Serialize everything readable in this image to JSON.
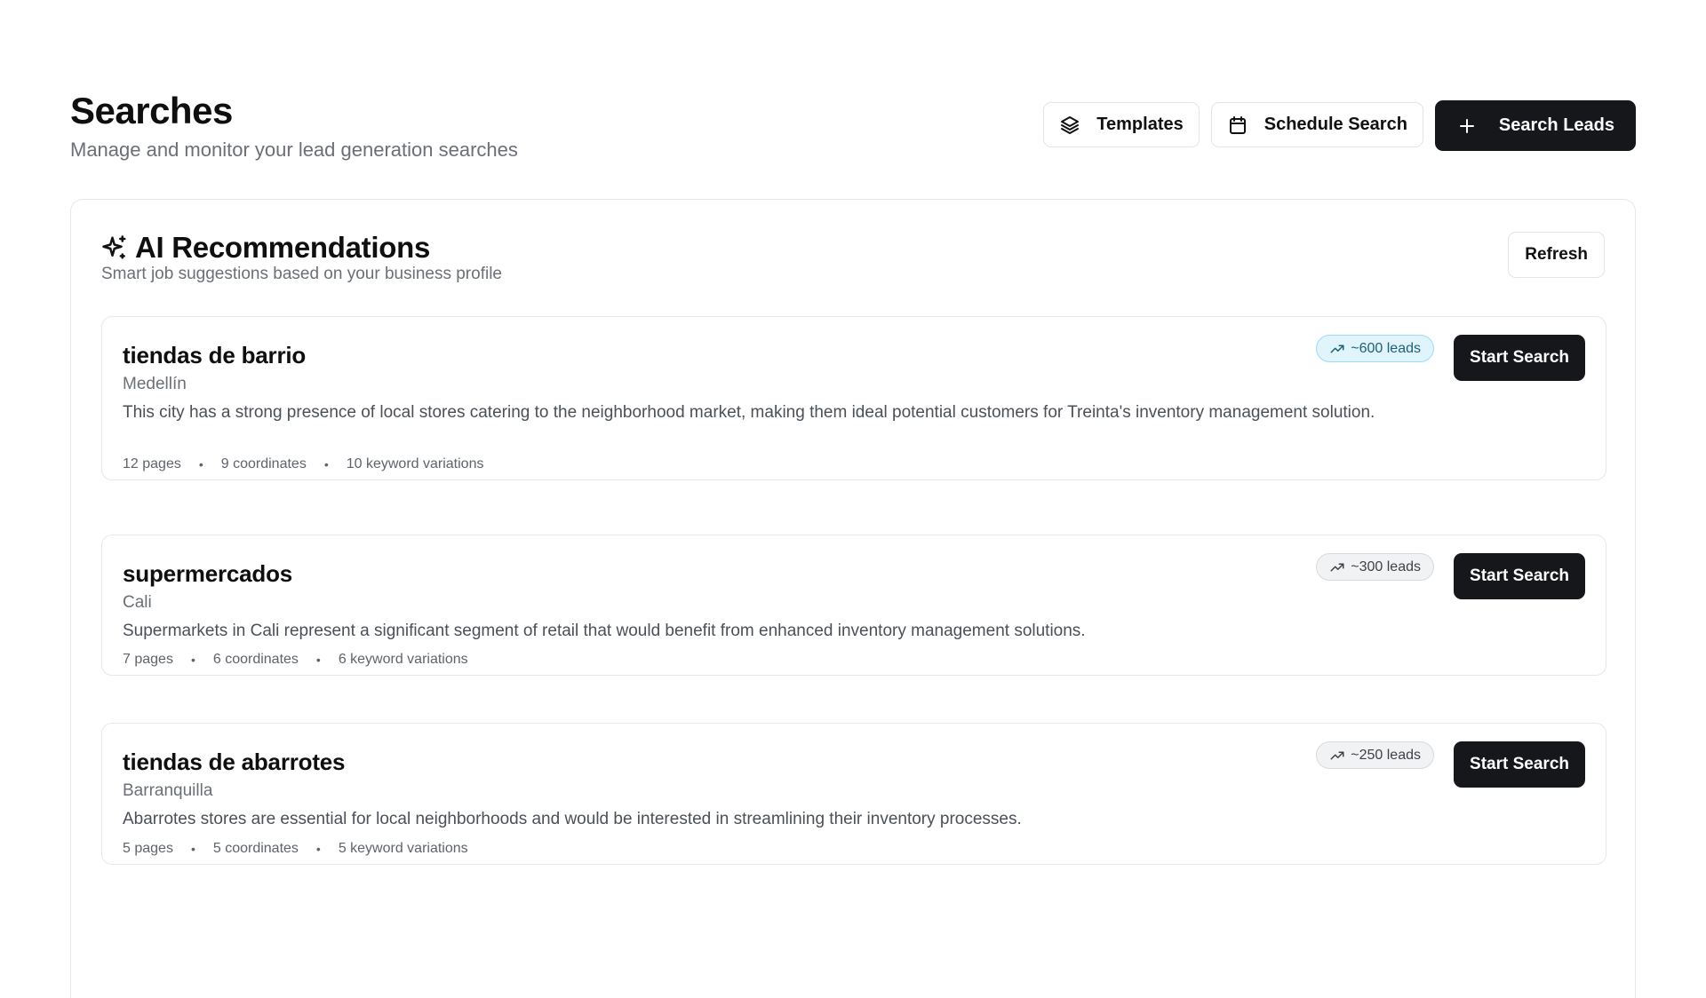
{
  "header": {
    "title": "Searches",
    "subtitle": "Manage and monitor your lead generation searches",
    "templates_label": "Templates",
    "schedule_label": "Schedule Search",
    "search_leads_label": "Search Leads"
  },
  "recommendations": {
    "title": "AI Recommendations",
    "subtitle": "Smart job suggestions based on your business profile",
    "refresh_label": "Refresh",
    "start_label": "Start Search",
    "items": [
      {
        "name": "tiendas de barrio",
        "city": "Medellín",
        "leads": "~600 leads",
        "description": "This city has a strong presence of local stores catering to the neighborhood market, making them ideal potential customers for Treinta's inventory management solution.",
        "pages": "12 pages",
        "coordinates": "9 coordinates",
        "keywords": "10 keyword variations"
      },
      {
        "name": "supermercados",
        "city": "Cali",
        "leads": "~300 leads",
        "description": "Supermarkets in Cali represent a significant segment of retail that would benefit from enhanced inventory management solutions.",
        "pages": "7 pages",
        "coordinates": "6 coordinates",
        "keywords": "6 keyword variations"
      },
      {
        "name": "tiendas de abarrotes",
        "city": "Barranquilla",
        "leads": "~250 leads",
        "description": "Abarrotes stores are essential for local neighborhoods and would be interested in streamlining their inventory processes.",
        "pages": "5 pages",
        "coordinates": "5 coordinates",
        "keywords": "5 keyword variations"
      }
    ]
  },
  "colors": {
    "primary_button": "#16171a",
    "hot_badge_bg": "#dff4fb",
    "hot_badge_border": "#9fdcf0"
  },
  "icons": {
    "templates": "layers-icon",
    "schedule": "calendar-icon",
    "search_leads": "plus-icon",
    "ai": "sparkles-icon",
    "leads": "trending-up-icon"
  }
}
